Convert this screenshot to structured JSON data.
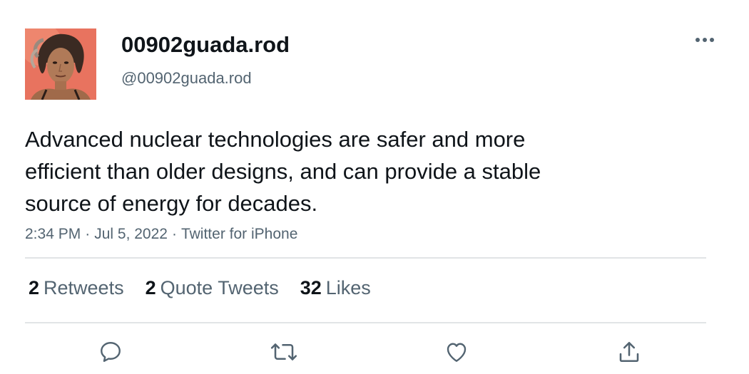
{
  "user": {
    "display_name": "00902guada.rod",
    "handle": "@00902guada.rod",
    "avatar_icon": "profile-photo"
  },
  "more_icon": "more-dots-icon",
  "tweet": {
    "text": "Advanced nuclear technologies are safer and more\nefficient than older designs, and can provide a stable\nsource of energy for decades.",
    "time": "2:34 PM",
    "date": "Jul 5, 2022",
    "source": "Twitter for iPhone",
    "separator": "·"
  },
  "stats": {
    "retweets": {
      "count": "2",
      "label": "Retweets"
    },
    "quote_tweets": {
      "count": "2",
      "label": "Quote Tweets"
    },
    "likes": {
      "count": "32",
      "label": "Likes"
    }
  },
  "actions": [
    {
      "icon": "reply-icon"
    },
    {
      "icon": "retweet-icon"
    },
    {
      "icon": "like-icon"
    },
    {
      "icon": "share-icon"
    }
  ],
  "colors": {
    "text_primary": "#0f1419",
    "text_secondary": "#536471",
    "divider": "#e1e4e6",
    "avatar_background": "#e8735f"
  }
}
